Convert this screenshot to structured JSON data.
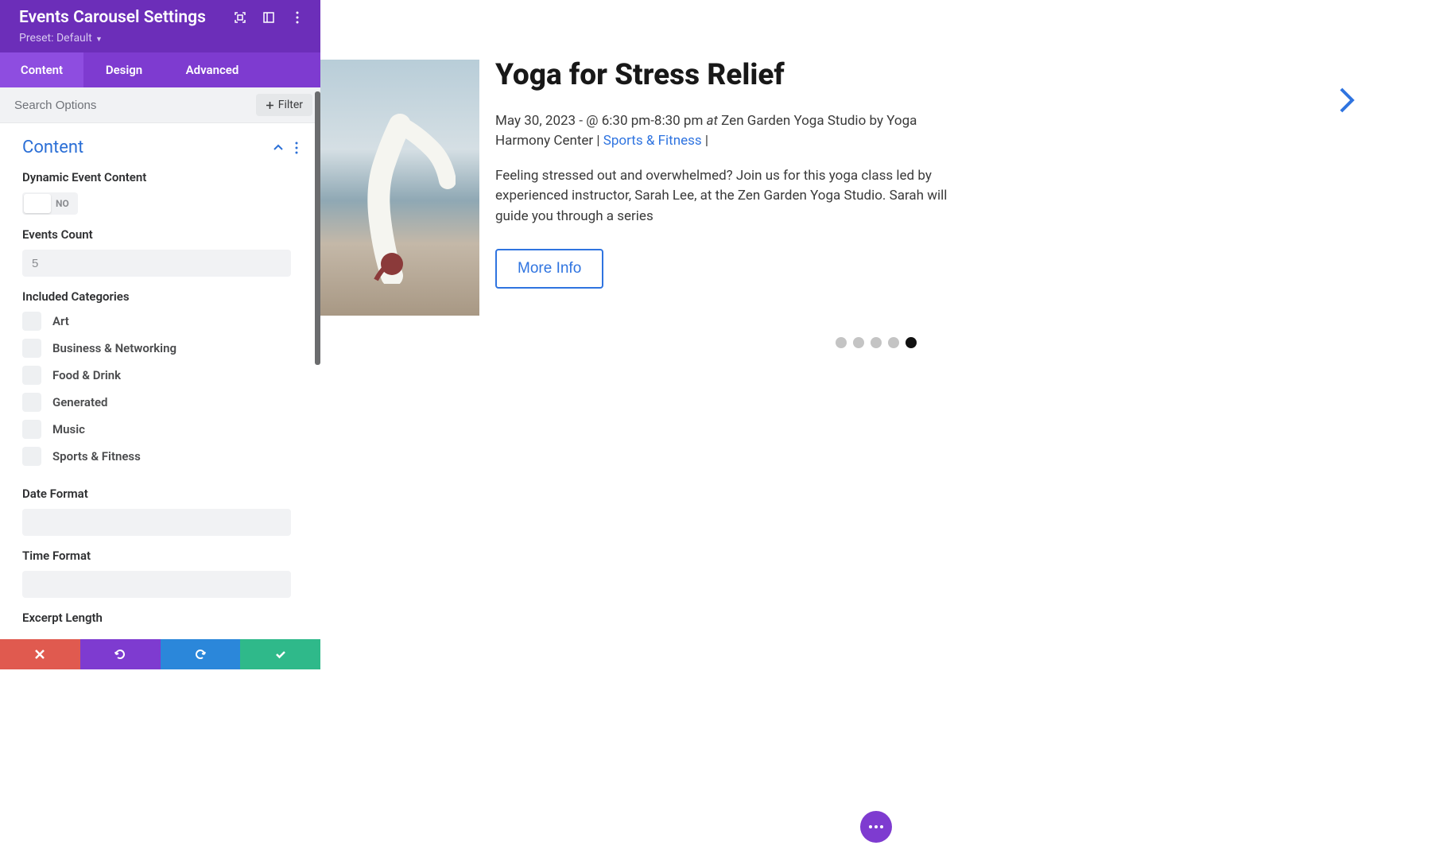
{
  "header": {
    "title": "Events Carousel Settings",
    "preset_label": "Preset: Default"
  },
  "tabs": {
    "content": "Content",
    "design": "Design",
    "advanced": "Advanced"
  },
  "search": {
    "placeholder": "Search Options",
    "filter_label": "Filter"
  },
  "section": {
    "title": "Content"
  },
  "fields": {
    "dynamic_label": "Dynamic Event Content",
    "dynamic_value": "NO",
    "events_count_label": "Events Count",
    "events_count_placeholder": "5",
    "included_categories_label": "Included Categories",
    "categories": [
      "Art",
      "Business & Networking",
      "Food & Drink",
      "Generated",
      "Music",
      "Sports & Fitness"
    ],
    "date_format_label": "Date Format",
    "time_format_label": "Time Format",
    "excerpt_length_label": "Excerpt Length"
  },
  "event": {
    "title": "Yoga for Stress Relief",
    "date": "May 30, 2023",
    "time": "@ 6:30 pm-8:30 pm",
    "at_word": "at",
    "venue": "Zen Garden Yoga Studio",
    "by_word": "by",
    "organizer": "Yoga Harmony Center",
    "category": "Sports & Fitness",
    "description": "Feeling stressed out and overwhelmed? Join us for this yoga class led by experienced instructor, Sarah Lee, at the Zen Garden Yoga Studio. Sarah will guide you through a series",
    "more_info": "More Info"
  },
  "pagination": {
    "total": 5,
    "active_index": 4
  },
  "colors": {
    "primary": "#7e3bd0",
    "accent_blue": "#2f74e0",
    "danger": "#e05a4f",
    "success": "#2fb98a",
    "info": "#2b87da"
  }
}
